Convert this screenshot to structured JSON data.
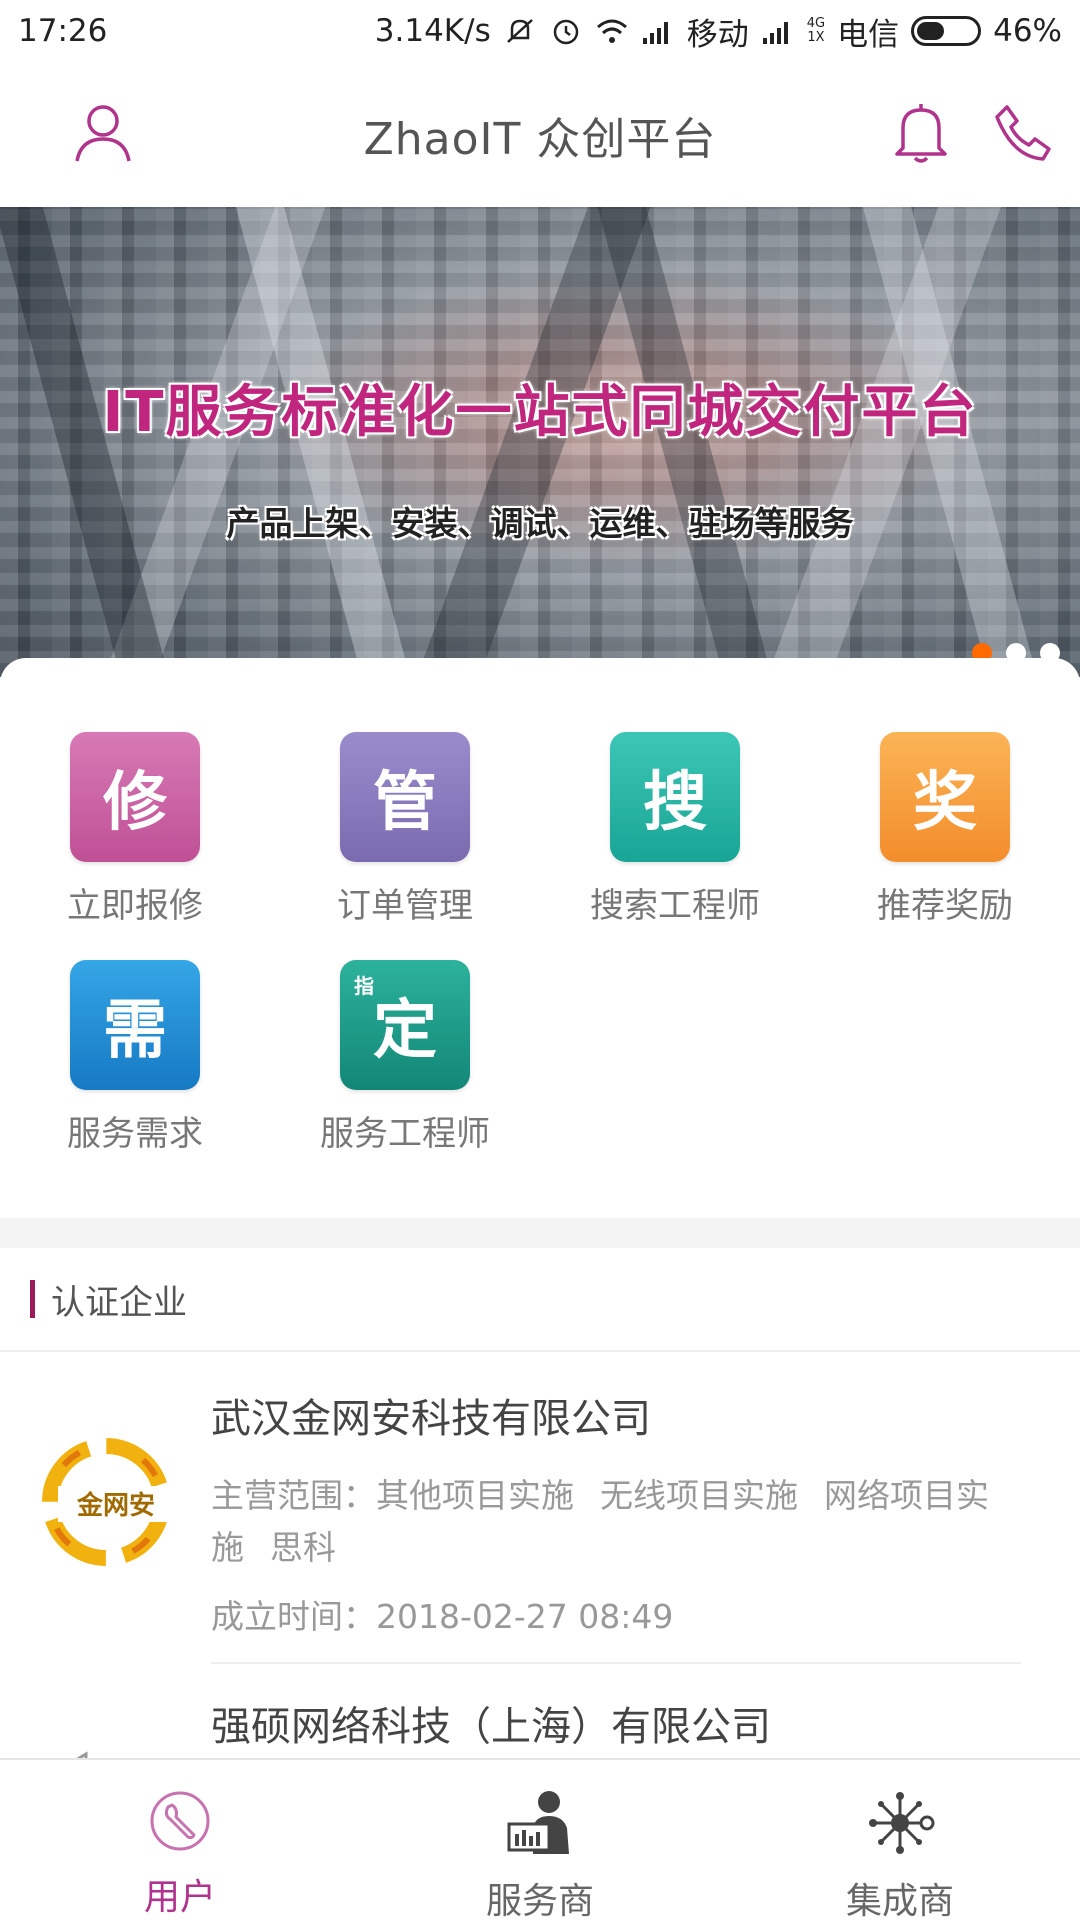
{
  "status_bar": {
    "time": "17:26",
    "speed": "3.14K/s",
    "carrier1": "移动",
    "net_top": "4G",
    "net_bottom": "1X",
    "carrier2": "电信",
    "battery": "46%",
    "battery_level": 0.46
  },
  "header": {
    "title": "ZhaoIT 众创平台",
    "icons": [
      "user-icon",
      "bell-icon",
      "phone-icon"
    ],
    "accent": "#b0348b"
  },
  "banner": {
    "headline": "IT服务标准化一站式同城交付平台",
    "subline": "产品上架、安装、调试、运维、驻场等服务",
    "active_dot": 0,
    "dot_count": 3,
    "dot_active_color": "#ff6a00"
  },
  "menu": [
    {
      "glyph": "修",
      "label": "立即报修",
      "color": "#cc5fa6"
    },
    {
      "glyph": "管",
      "label": "订单管理",
      "color": "#8a7cc0"
    },
    {
      "glyph": "搜",
      "label": "搜索工程师",
      "color": "#25b3a4"
    },
    {
      "glyph": "奖",
      "label": "推荐奖励",
      "color": "#f7a03f"
    },
    {
      "glyph": "需",
      "label": "服务需求",
      "color": "#1e8fd6"
    },
    {
      "glyph": "定",
      "small": "指",
      "label": "服务工程师",
      "color": "#1a9f8a"
    }
  ],
  "certified": {
    "title": "认证企业",
    "companies": [
      {
        "name": "武汉金网安科技有限公司",
        "logo_text": "金网安",
        "scope_label": "主营范围：",
        "scope": [
          "其他项目实施",
          "无线项目实施",
          "网络项目实施",
          "思科"
        ],
        "date_label": "成立时间：",
        "date": "2018-02-27 08:49"
      },
      {
        "name": "强硕网络科技（上海）有限公司"
      }
    ]
  },
  "bottom_nav": [
    {
      "label": "用户",
      "icon": "wrench-icon",
      "active": true
    },
    {
      "label": "服务商",
      "icon": "service-provider-icon",
      "active": false
    },
    {
      "label": "集成商",
      "icon": "network-hub-icon",
      "active": false
    }
  ]
}
